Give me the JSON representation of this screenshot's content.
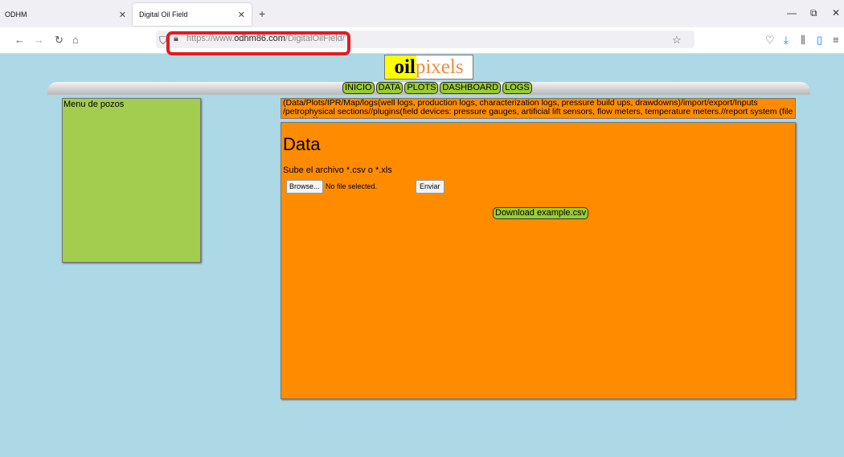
{
  "browser": {
    "tabs": [
      {
        "label": "ODHM"
      },
      {
        "label": "Digital Oil Field"
      }
    ],
    "url_prefix": "https://www.",
    "url_host": "odhm86.com",
    "url_path": "/DigitalOilField/"
  },
  "logo": {
    "part1": "oil",
    "part2": "pixels"
  },
  "menu": [
    "INICIO",
    "DATA",
    "PLOTS",
    "DASHBOARD",
    "LOGS"
  ],
  "sidebar": {
    "title": "Menu de pozos"
  },
  "info_text": "(Data/Plots/IPR/Map/logs(well logs, production logs, characterization logs, pressure build ups, drawdowns)/import/export/Inputs /petrophysical sections//plugins(field devices: pressure gauges, artificial lift sensors, flow meters, temperature meters.//report system (file creation))",
  "main": {
    "heading": "Data",
    "subtitle": "Sube el archivo *.csv o *.xls",
    "browse_label": "Browse...",
    "no_file": "No file selected.",
    "submit_label": "Enviar",
    "download_label": "Download example.csv"
  },
  "colors": {
    "page_bg": "#add8e6",
    "panel": "#ff8c00",
    "sidebar": "#a2cd4f",
    "button": "#9acd32",
    "highlight": "#e31b23"
  }
}
